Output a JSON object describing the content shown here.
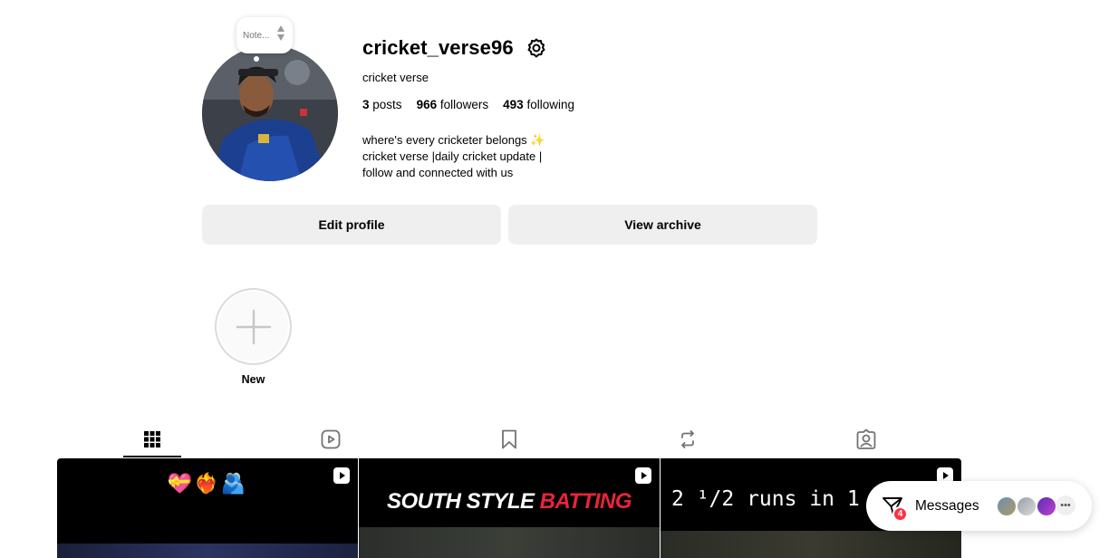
{
  "profile": {
    "username": "cricket_verse96",
    "full_name": "cricket verse",
    "note_placeholder": "Note...",
    "stats": {
      "posts_count": "3",
      "posts_label": "posts",
      "followers_count": "966",
      "followers_label": "followers",
      "following_count": "493",
      "following_label": "following"
    },
    "bio": [
      "where's every cricketer belongs ✨",
      "cricket verse |daily cricket update |",
      "follow and connected with us"
    ]
  },
  "actions": {
    "edit_profile": "Edit profile",
    "view_archive": "View archive"
  },
  "highlights": {
    "new_label": "New"
  },
  "tabs": [
    {
      "name": "posts-grid",
      "icon": "grid-icon",
      "active": true
    },
    {
      "name": "reels",
      "icon": "reels-icon",
      "active": false
    },
    {
      "name": "saved",
      "icon": "bookmark-icon",
      "active": false
    },
    {
      "name": "reposts",
      "icon": "repost-icon",
      "active": false
    },
    {
      "name": "tagged",
      "icon": "tagged-icon",
      "active": false
    }
  ],
  "posts": [
    {
      "type": "reel",
      "emoji": "💝❤️‍🔥🫂"
    },
    {
      "type": "reel",
      "title_white": "SOUTH STYLE ",
      "title_red": "BATTING"
    },
    {
      "type": "reel",
      "text": "2 ¹/2 runs in 1 b"
    }
  ],
  "messages": {
    "label": "Messages",
    "unread_count": "4",
    "more_icon": "more-horizontal-icon"
  },
  "colors": {
    "button_bg": "#efefef",
    "badge_red": "#ff3040",
    "accent_red": "#e8243a"
  }
}
